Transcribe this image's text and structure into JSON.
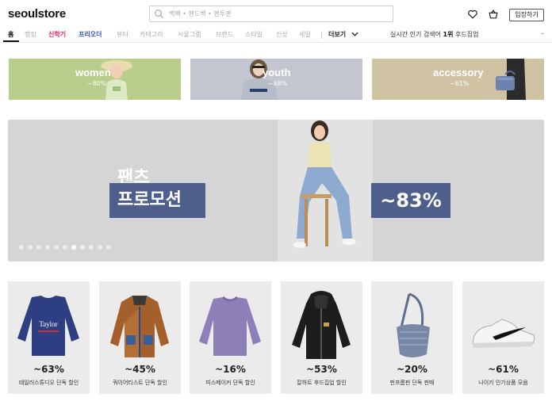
{
  "header": {
    "logo": "seoulstore",
    "search_placeholder": "백팩 • 핸드백 • 맨투맨",
    "login_label": "입장하기"
  },
  "nav": {
    "items": [
      "홈",
      "랭킹",
      "신학기",
      "프리오더",
      "뷰티",
      "카테고리",
      "서울그램",
      "브랜드",
      "스타일",
      "신상",
      "세일",
      "더보기"
    ],
    "realtime_prefix": "실시간 인기 검색어",
    "realtime_rank": "1위",
    "realtime_term": "후드집업",
    "dash": "–"
  },
  "categories": [
    {
      "title": "women",
      "discount": "~80%",
      "bg": "#b9cd8c"
    },
    {
      "title": "youth",
      "discount": "~68%",
      "bg": "#c3c6d0"
    },
    {
      "title": "accessory",
      "discount": "~61%",
      "bg": "#cfc3a4"
    }
  ],
  "hero": {
    "line1": "팬츠",
    "line2": "프로모션",
    "discount": "~83%",
    "slide_count": 11,
    "active_slide": 6
  },
  "products": [
    {
      "discount": "~63%",
      "name": "테일러스튜디오 단독 할인",
      "icon": "navy-sweatshirt-icon"
    },
    {
      "discount": "~45%",
      "name": "쿼이어티스트 단독 할인",
      "icon": "fleece-jacket-icon"
    },
    {
      "discount": "~16%",
      "name": "피스메이커 단독 할인",
      "icon": "purple-sweater-icon"
    },
    {
      "discount": "~53%",
      "name": "칼하트 후드집업 할인",
      "icon": "black-hoodie-icon"
    },
    {
      "discount": "~20%",
      "name": "펀프롬펀 단독 판매",
      "icon": "denim-bag-icon"
    },
    {
      "discount": "~61%",
      "name": "나이키 인기상품 모음",
      "icon": "sneaker-icon"
    }
  ]
}
